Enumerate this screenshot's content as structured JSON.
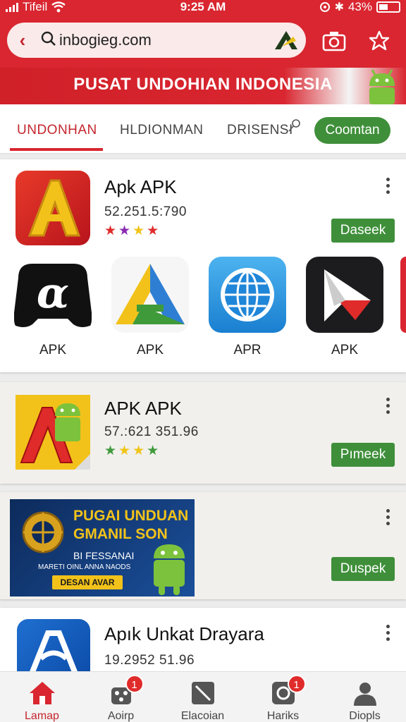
{
  "status": {
    "carrier": "Tifeil",
    "time": "9:25 AM",
    "battery": "43%"
  },
  "browser": {
    "url": "inbogieg.com"
  },
  "banner": {
    "title": "PUSAT UNDOHIAN INDONESIA"
  },
  "tabs": [
    {
      "label": "UNDONHAN",
      "active": true
    },
    {
      "label": "HLDIONMAN"
    },
    {
      "label": "DRISENSI"
    }
  ],
  "tab_button": "Coomtan",
  "cards": [
    {
      "title": "Apk APK",
      "number": "52.251.5:790",
      "button": "Daseek"
    },
    {
      "title": "APK APK",
      "number": "57.:621 351.96",
      "button": "Pımeek"
    },
    {
      "button": "Duspek"
    },
    {
      "title": "Apık Unkat Drayara",
      "number": "19.2952 51.96"
    }
  ],
  "featured_apps": [
    {
      "label": "APK",
      "icon": "alpha-icon"
    },
    {
      "label": "APK",
      "icon": "drive-icon"
    },
    {
      "label": "APR",
      "icon": "globe-icon"
    },
    {
      "label": "APK",
      "icon": "arrow-a-icon"
    }
  ],
  "promo": {
    "line1": "PUGAI UNDUAN",
    "line2": "GMANIL SON",
    "line3": "BI FESSANAI",
    "line4": "MARETI OINL ANNA NAODS",
    "cta": "DESAN AVAR"
  },
  "nav": [
    {
      "label": "Lamap",
      "icon": "home-icon",
      "active": true
    },
    {
      "label": "Aoirp",
      "icon": "apps-icon",
      "badge": "1"
    },
    {
      "label": "Elacoian",
      "icon": "edit-icon"
    },
    {
      "label": "Hariks",
      "icon": "refresh-icon",
      "badge": "1"
    },
    {
      "label": "Diopls",
      "icon": "profile-icon"
    }
  ],
  "colors": {
    "brand_red": "#d92630",
    "action_green": "#3f8f3a"
  }
}
